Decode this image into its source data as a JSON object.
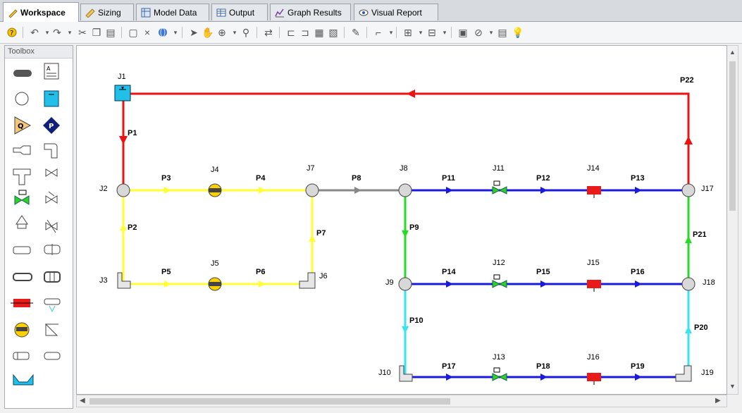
{
  "tabs": [
    {
      "label": "Workspace",
      "icon": "pencil-icon",
      "active": true
    },
    {
      "label": "Sizing",
      "icon": "ruler-icon",
      "active": false
    },
    {
      "label": "Model Data",
      "icon": "table-icon",
      "active": false
    },
    {
      "label": "Output",
      "icon": "grid-icon",
      "active": false
    },
    {
      "label": "Graph Results",
      "icon": "graph-icon",
      "active": false
    },
    {
      "label": "Visual Report",
      "icon": "eye-icon",
      "active": false
    }
  ],
  "toolbox": {
    "title": "Toolbox"
  },
  "colors": {
    "red": "#ee1111",
    "yellow": "#ffff33",
    "gray": "#888888",
    "blue": "#1a1adc",
    "green": "#22dd22",
    "cyan": "#33e6f2"
  },
  "junctions": {
    "J1": "J1",
    "J2": "J2",
    "J3": "J3",
    "J4": "J4",
    "J5": "J5",
    "J6": "J6",
    "J7": "J7",
    "J8": "J8",
    "J9": "J9",
    "J10": "J10",
    "J11": "J11",
    "J12": "J12",
    "J13": "J13",
    "J14": "J14",
    "J15": "J15",
    "J16": "J16",
    "J17": "J17",
    "J18": "J18",
    "J19": "J19"
  },
  "pipes": {
    "P1": "P1",
    "P2": "P2",
    "P3": "P3",
    "P4": "P4",
    "P5": "P5",
    "P6": "P6",
    "P7": "P7",
    "P8": "P8",
    "P9": "P9",
    "P10": "P10",
    "P11": "P11",
    "P12": "P12",
    "P13": "P13",
    "P14": "P14",
    "P15": "P15",
    "P16": "P16",
    "P17": "P17",
    "P18": "P18",
    "P19": "P19",
    "P20": "P20",
    "P21": "P21",
    "P22": "P22"
  }
}
